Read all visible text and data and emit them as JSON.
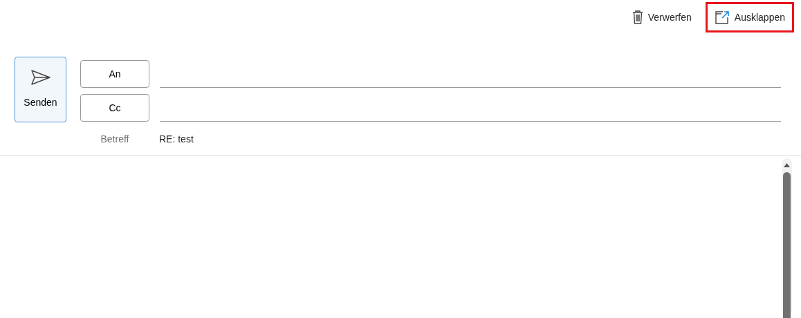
{
  "toolbar": {
    "actions": [
      {
        "kind": "discard",
        "label": "Verwerfen",
        "highlighted": false
      },
      {
        "kind": "popout",
        "label": "Ausklappen",
        "highlighted": true
      }
    ]
  },
  "send_button": {
    "label": "Senden"
  },
  "recipients": [
    {
      "label": "An"
    },
    {
      "label": "Cc"
    }
  ],
  "subject": {
    "label": "Betreff",
    "value": "RE: test"
  }
}
